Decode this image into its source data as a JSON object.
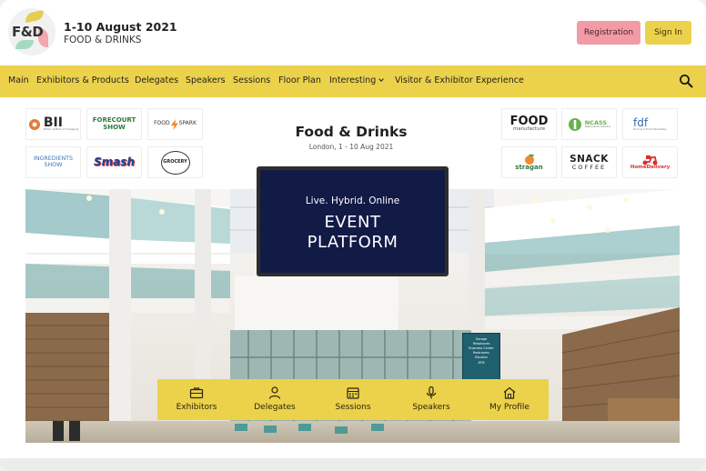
{
  "header": {
    "logo_text": "F&D",
    "event_dates": "1-10 August 2021",
    "event_name": "FOOD & DRINKS",
    "registration_label": "Registration",
    "signin_label": "Sign In"
  },
  "nav": {
    "items": [
      "Main",
      "Exhibitors & Products",
      "Delegates",
      "Speakers",
      "Sessions",
      "Floor Plan",
      "Interesting",
      "Visitor & Exhibitor Experience"
    ],
    "search_icon": "search-icon"
  },
  "sponsors_left": [
    {
      "line1": "BII",
      "line2": "British Institute of Innkeeping"
    },
    {
      "line1": "FORECOURT",
      "line2": "SHOW"
    },
    {
      "line1": "FOOD",
      "line2": "SPARK"
    },
    {
      "line1": "INGREDIENTS",
      "line2": "SHOW"
    },
    {
      "line1": "Smash",
      "line2": ""
    },
    {
      "line1": "GROCERY",
      "line2": ""
    }
  ],
  "sponsors_right": [
    {
      "line1": "FOOD",
      "line2": "manufacture"
    },
    {
      "line1": "NCASS",
      "line2": "Nationwide Caterers"
    },
    {
      "line1": "fdf",
      "line2": "Food and Drink Federation"
    },
    {
      "line1": "stragan",
      "line2": ""
    },
    {
      "line1": "SNACK",
      "line2": "COFFEE"
    },
    {
      "line1": "HomeDelivery",
      "line2": ""
    }
  ],
  "event": {
    "title": "Food & Drinks",
    "subtitle": "London,  1 - 10 Aug 2021"
  },
  "screen": {
    "tagline": "Live. Hybrid. Online",
    "line1": "EVENT",
    "line2": "PLATFORM"
  },
  "hall_sign": {
    "lines": [
      "Garage",
      "Telephones",
      "Business Center",
      "Restrooms",
      "Elevator",
      "ATM"
    ]
  },
  "quick_nav": [
    {
      "label": "Exhibitors",
      "icon": "briefcase-icon"
    },
    {
      "label": "Delegates",
      "icon": "user-icon"
    },
    {
      "label": "Sessions",
      "icon": "calendar-icon"
    },
    {
      "label": "Speakers",
      "icon": "microphone-icon"
    },
    {
      "label": "My Profile",
      "icon": "home-icon"
    }
  ],
  "colors": {
    "accent_yellow": "#ecd14b",
    "registration_pink": "#f29aa6",
    "screen_navy": "#121a46"
  }
}
